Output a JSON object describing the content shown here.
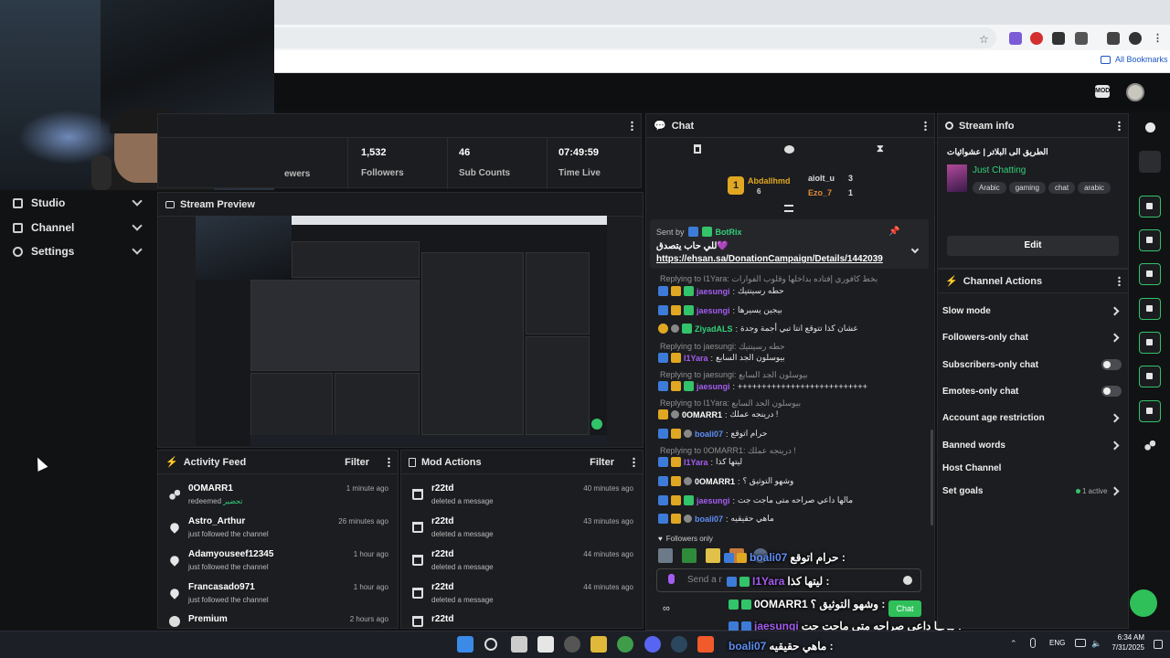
{
  "browser": {
    "bookmarks_label": "All Bookmarks"
  },
  "nav": {
    "items": [
      {
        "label": "Studio"
      },
      {
        "label": "Channel"
      },
      {
        "label": "Settings"
      }
    ]
  },
  "stats": {
    "cells": [
      {
        "value": "",
        "label": "ewers"
      },
      {
        "value": "1,532",
        "label": "Followers"
      },
      {
        "value": "46",
        "label": "Sub Counts"
      },
      {
        "value": "07:49:59",
        "label": "Time Live"
      }
    ]
  },
  "preview": {
    "title": "Stream Preview"
  },
  "activity": {
    "title": "Activity Feed",
    "filter": "Filter",
    "items": [
      {
        "name": "0OMARR1",
        "text": "redeemed",
        "reward": "تحضير",
        "time": "1 minute ago",
        "icon": "points-icon"
      },
      {
        "name": "Astro_Arthur",
        "text": "just followed the channel",
        "time": "26 minutes ago",
        "icon": "heart-icon"
      },
      {
        "name": "Adamyouseef12345",
        "text": "just followed the channel",
        "time": "1 hour ago",
        "icon": "heart-icon"
      },
      {
        "name": "Francasado971",
        "text": "just followed the channel",
        "time": "1 hour ago",
        "icon": "heart-icon"
      },
      {
        "name": "Premium",
        "text": "",
        "time": "2 hours ago",
        "icon": "points-icon"
      }
    ]
  },
  "mod": {
    "title": "Mod Actions",
    "filter": "Filter",
    "items": [
      {
        "name": "r22td",
        "text": "deleted a message",
        "time": "40 minutes ago"
      },
      {
        "name": "r22td",
        "text": "deleted a message",
        "time": "43 minutes ago"
      },
      {
        "name": "r22td",
        "text": "deleted a message",
        "time": "44 minutes ago"
      },
      {
        "name": "r22td",
        "text": "deleted a message",
        "time": "44 minutes ago"
      },
      {
        "name": "r22td",
        "text": "",
        "time": ""
      }
    ]
  },
  "chat": {
    "title": "Chat",
    "leaders": {
      "first": {
        "name": "Abdallhmd",
        "count": "6"
      },
      "second": {
        "name": "aiolt_u",
        "count": "3"
      },
      "third": {
        "name": "Ezo_7",
        "count": "1"
      }
    },
    "pinned": {
      "sent_by": "Sent by",
      "bot": "BotRix",
      "text": "للي حاب يتصدق💜",
      "link": "https://ehsan.sa/DonationCampaign/Details/1442039"
    },
    "messages": [
      {
        "reply": "Replying to I1Yara: بخط كافوري إفتاده بداخلها وقلوب الفوارات"
      },
      {
        "user": "jaesungi",
        "color": "pur",
        "text": "حطه رسينتيك"
      },
      {
        "user": "jaesungi",
        "color": "pur",
        "text": "بيجين يسيرها"
      },
      {
        "user": "ZiyadALS",
        "color": "grn",
        "text": "عشان كذا تتوقع انتا تبي أجمة وجدة"
      },
      {
        "reply": "Replying to jaesungi: حطه رسينتيك"
      },
      {
        "user": "I1Yara",
        "color": "pur",
        "text": "بيوسلون الجد السابع"
      },
      {
        "reply": "Replying to jaesungi: بيوسلون الجد السابع"
      },
      {
        "user": "jaesungi",
        "color": "pur",
        "text": "+++++++++++++++++++++++++++"
      },
      {
        "reply": "Replying to I1Yara: بيوسلون الجد السابع"
      },
      {
        "user": "0OMARR1",
        "color": "wht",
        "text": "درينجه عملك !"
      },
      {
        "user": "boali07",
        "color": "blue",
        "text": "حرام اتوقع"
      },
      {
        "reply": "Replying to 0OMARR1: درينجه عملك !"
      },
      {
        "user": "I1Yara",
        "color": "pur",
        "text": "ليتها كذا"
      },
      {
        "user": "0OMARR1",
        "color": "wht",
        "text": "وشهو التوثيق ؟"
      },
      {
        "user": "jaesungi",
        "color": "pur",
        "text": "مالها داعي صراحه متى ماجت جت"
      },
      {
        "user": "boali07",
        "color": "blue",
        "text": "ماهي حقيقيه"
      }
    ],
    "followers_only": "Followers only",
    "input_placeholder": "Send a message",
    "send": "Chat"
  },
  "overlay": {
    "lines": [
      {
        "user": "boali07",
        "text": "حرام اتوقع :"
      },
      {
        "user": "I1Yara",
        "text": "ليتها كذا :"
      },
      {
        "user": "0OMARR1",
        "text": "وشهو التوثيق ؟ :"
      },
      {
        "user": "jaesungi",
        "text": "مالها داعي صراحه متى ماجت جت :"
      },
      {
        "user": "boali07",
        "text": "ماهي حقيقيه :"
      }
    ]
  },
  "info": {
    "title": "Stream info",
    "stream_title": "الطريق الى البلاتر | عشوائيات",
    "category": "Just Chatting",
    "tags": [
      "Arabic",
      "gaming",
      "chat",
      "arabic"
    ],
    "edit": "Edit"
  },
  "actions": {
    "title": "Channel Actions",
    "items": [
      "Slow mode",
      "Followers-only chat",
      "Subscribers-only chat",
      "Emotes-only chat",
      "Account age restriction",
      "Banned words",
      "Host Channel",
      "Set goals"
    ],
    "goals_status": "1 active"
  },
  "clock": {
    "time": "6:34 AM",
    "date": "7/31/2025",
    "lang": "ENG"
  }
}
